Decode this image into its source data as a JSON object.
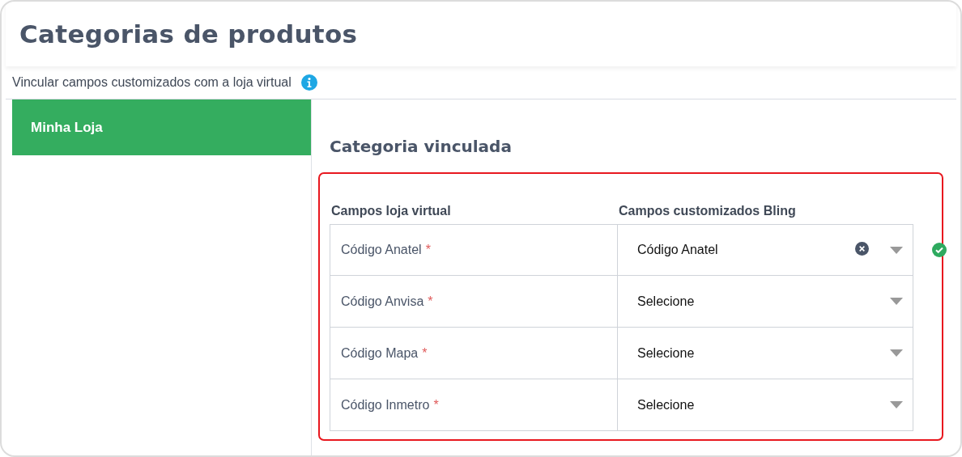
{
  "page_title": "Categorias de produtos",
  "subtitle": "Vincular campos customizados com a loja virtual",
  "sidebar": {
    "items": [
      {
        "label": "Minha Loja",
        "selected": true
      }
    ]
  },
  "section_title": "Categoria vinculada",
  "table": {
    "columns": [
      "Campos loja virtual",
      "Campos customizados Bling"
    ],
    "rows": [
      {
        "field": "Código Anatel",
        "required_mark": "*",
        "value": "Código Anatel",
        "clearable": true,
        "valid": true
      },
      {
        "field": "Código Anvisa",
        "required_mark": "*",
        "placeholder": "Selecione",
        "clearable": false,
        "valid": false
      },
      {
        "field": "Código Mapa",
        "required_mark": "*",
        "placeholder": "Selecione",
        "clearable": false,
        "valid": false
      },
      {
        "field": "Código Inmetro",
        "required_mark": "*",
        "placeholder": "Selecione",
        "clearable": false,
        "valid": false
      }
    ]
  }
}
